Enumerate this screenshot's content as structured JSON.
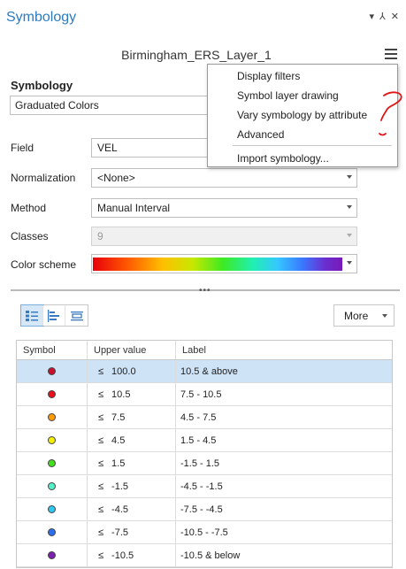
{
  "pane": {
    "title": "Symbology",
    "controls": [
      "▾",
      "⅄",
      "✕"
    ]
  },
  "layer_name": "Birmingham_ERS_Layer_1",
  "section": {
    "label": "Symbology",
    "renderer": "Graduated Colors"
  },
  "fields": {
    "field": {
      "label": "Field",
      "value": "VEL"
    },
    "normalization": {
      "label": "Normalization",
      "value": "<None>"
    },
    "method": {
      "label": "Method",
      "value": "Manual Interval"
    },
    "classes": {
      "label": "Classes",
      "value": "9"
    },
    "color_scheme": {
      "label": "Color scheme"
    }
  },
  "more_button": "More",
  "table": {
    "headers": [
      "Symbol",
      "Upper value",
      "Label"
    ],
    "rows": [
      {
        "le": "≤",
        "upper": "100.0",
        "label": "10.5 & above",
        "color": "#c8102e"
      },
      {
        "le": "≤",
        "upper": "10.5",
        "label": "7.5 - 10.5",
        "color": "#e8101e"
      },
      {
        "le": "≤",
        "upper": "7.5",
        "label": "4.5 - 7.5",
        "color": "#ff9a00"
      },
      {
        "le": "≤",
        "upper": "4.5",
        "label": "1.5 - 4.5",
        "color": "#f4f000"
      },
      {
        "le": "≤",
        "upper": "1.5",
        "label": "-1.5 - 1.5",
        "color": "#44dd22"
      },
      {
        "le": "≤",
        "upper": "-1.5",
        "label": "-4.5 - -1.5",
        "color": "#55f0c8"
      },
      {
        "le": "≤",
        "upper": "-4.5",
        "label": "-7.5 - -4.5",
        "color": "#30c8f0"
      },
      {
        "le": "≤",
        "upper": "-7.5",
        "label": "-10.5 - -7.5",
        "color": "#2a6ff0"
      },
      {
        "le": "≤",
        "upper": "-10.5",
        "label": "-10.5 & below",
        "color": "#7a1fb0"
      }
    ]
  },
  "menu": {
    "items": [
      "Display filters",
      "Symbol layer drawing",
      "Vary symbology by attribute",
      "Advanced"
    ],
    "import": "Import symbology..."
  }
}
